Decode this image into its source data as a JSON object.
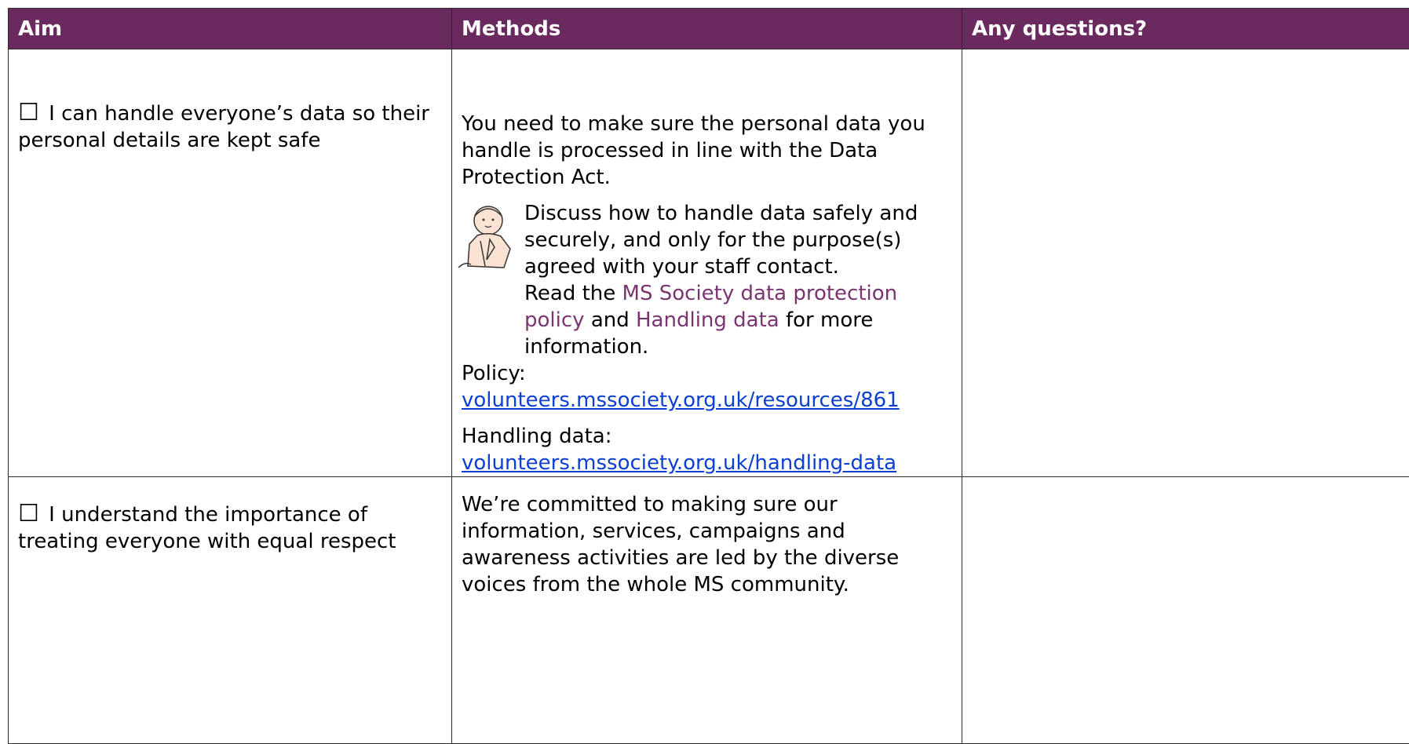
{
  "headers": {
    "aim": "Aim",
    "methods": "Methods",
    "questions": "Any questions?"
  },
  "row1": {
    "checkbox": "☐",
    "aim": "I can handle everyone’s data so their personal details are kept safe",
    "intro": "You need to make sure the personal data you handle is processed in line with the Data Protection Act.",
    "discuss": "Discuss how to handle data safely and securely, and only for the purpose(s) agreed with your staff contact.",
    "read_prefix": "Read the",
    "link1": "MS Society data protection policy",
    "read_mid": "and",
    "link2": "Handling data",
    "read_suffix": "for more information.",
    "policy_label": "Policy:",
    "policy_url": "volunteers.mssociety.org.uk/resources/861",
    "handling_label": "Handling data:",
    "handling_url": "volunteers.mssociety.org.uk/handling-data"
  },
  "row2": {
    "checkbox": "☐",
    "aim": "I understand the importance of treating everyone with equal respect",
    "methods": "We’re committed to making sure our information, services, campaigns and awareness activities are led by the diverse voices from the whole MS community."
  }
}
